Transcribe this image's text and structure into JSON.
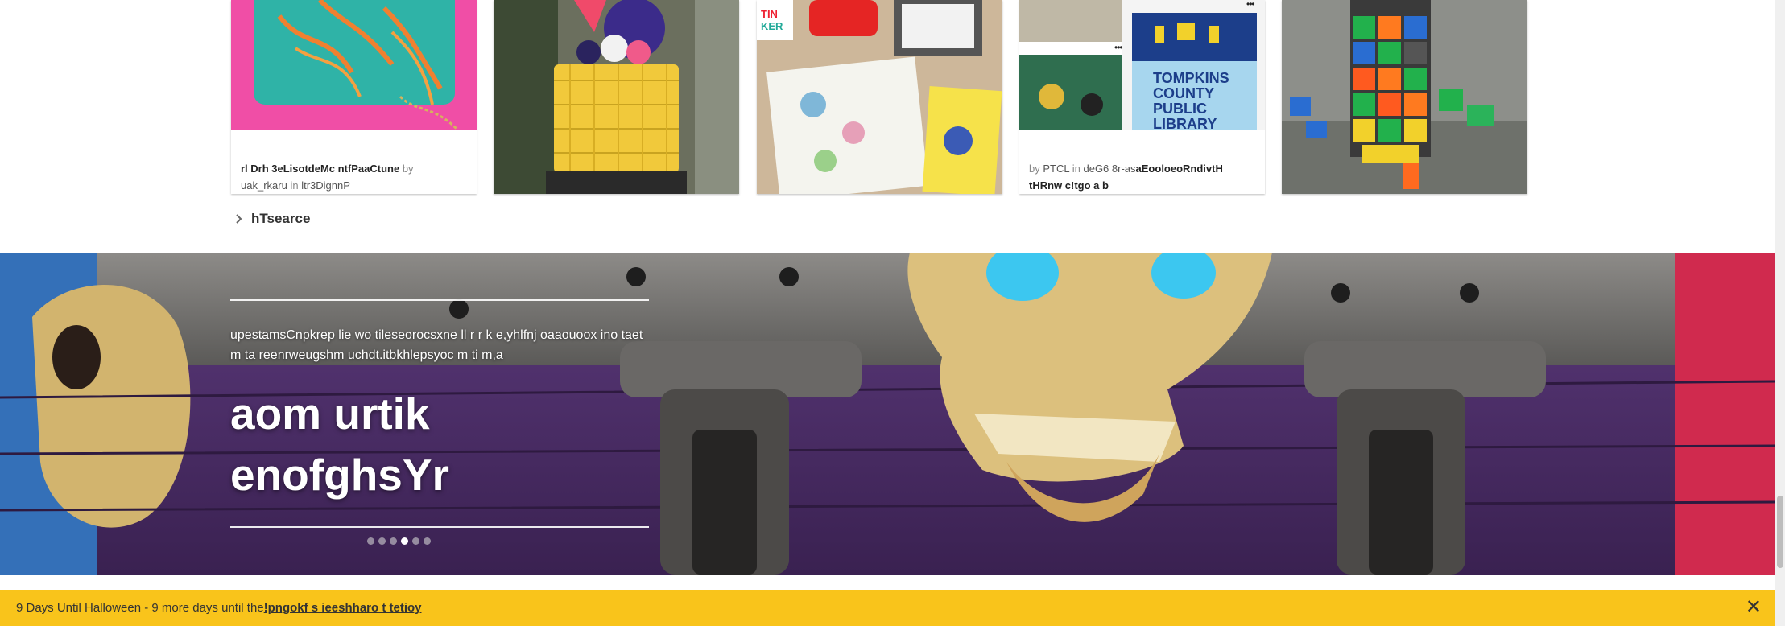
{
  "cards": [
    {
      "title": "rl Drh 3eLisotdeMc ntfPaaCtune",
      "by_word": "by",
      "author": "uak_rkaru",
      "in_word": "in",
      "category": "ltr3DignnP"
    },
    {
      "title": ""
    },
    {
      "title": ""
    },
    {
      "prefix_by": "by",
      "author": "PTCL",
      "in_word": "in",
      "category": "deG6 8r-as",
      "title": "aEooloeoRndivtH tHRnw c!tgo a b",
      "library_sign": [
        "TOMPKINS",
        "COUNTY",
        "PUBLIC",
        "LIBRARY"
      ],
      "more_glyph": "•••"
    },
    {
      "title": ""
    }
  ],
  "see_more": {
    "label": "hTsearce"
  },
  "hero": {
    "description": "upestamsCnpkrep lie wo tileseorocsxne ll r r k e,yhlfnj oaaouoox ino taet m ta reenrweugshm uchdt.itbkhlepsyoc m ti m,a",
    "title_line1": "aom urtik",
    "title_line2": "enofghsYr",
    "slides": 6,
    "active_slide": 4
  },
  "banner": {
    "text": "9 Days Until Halloween - 9 more days until the ",
    "link": "!pngokf s ieeshharo t tetioy",
    "close_glyph": "✕"
  },
  "colors": {
    "banner": "#f9c41b",
    "hero_bg": "#4a2a62"
  }
}
